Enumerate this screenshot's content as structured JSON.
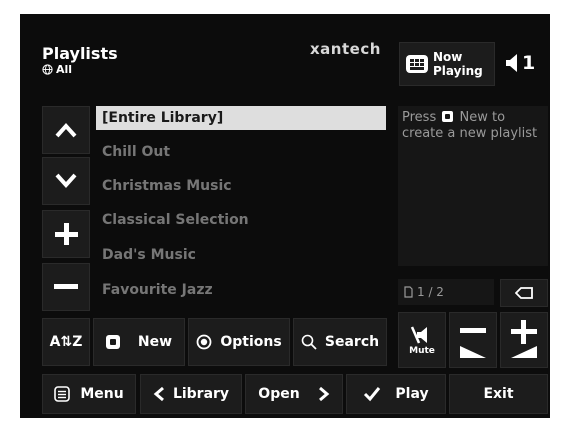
{
  "header": {
    "title": "Playlists",
    "subtitle": "All",
    "brand": "xantech",
    "now_playing_label": "Now Playing",
    "zone": "1"
  },
  "playlists": [
    {
      "label": "[Entire Library]",
      "selected": true
    },
    {
      "label": "Chill Out",
      "selected": false
    },
    {
      "label": "Christmas Music",
      "selected": false
    },
    {
      "label": "Classical Selection",
      "selected": false
    },
    {
      "label": "Dad's Music",
      "selected": false
    },
    {
      "label": "Favourite Jazz",
      "selected": false
    }
  ],
  "info": {
    "text_before": "Press",
    "text_after": "New to create a new playlist"
  },
  "pagination": {
    "page_text": "1 / 2"
  },
  "actions": {
    "sort_label": "A⇅Z",
    "new_label": "New",
    "options_label": "Options",
    "search_label": "Search",
    "mute_label": "Mute"
  },
  "bottom": {
    "menu_label": "Menu",
    "library_label": "Library",
    "open_label": "Open",
    "play_label": "Play",
    "exit_label": "Exit"
  },
  "colors": {
    "background": "#0c0c0c",
    "button": "#1c1c1c",
    "selected_row": "#dedede",
    "inactive_text": "#767676"
  }
}
